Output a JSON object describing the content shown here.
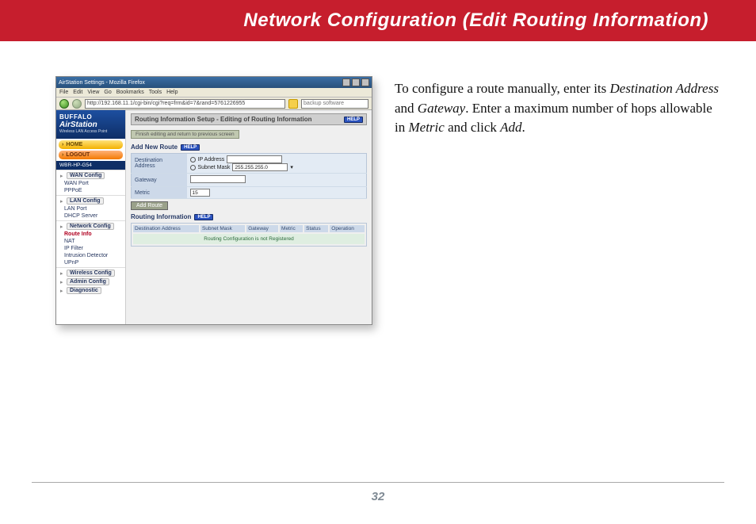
{
  "header": {
    "title": "Network Configuration (Edit Routing Information)"
  },
  "instructions": {
    "part1": "To configure a route manually, enter its ",
    "dest": "Destination Address",
    "part2": " and ",
    "gw": "Gateway",
    "part3": ".  Enter a maximum number of hops allowable in ",
    "metric": "Metric",
    "part4": " and click ",
    "add": "Add",
    "part5": "."
  },
  "page_number": "32",
  "browser": {
    "title": "AirStation Settings - Mozilla Firefox",
    "menus": [
      "File",
      "Edit",
      "View",
      "Go",
      "Bookmarks",
      "Tools",
      "Help"
    ],
    "url": "http://192.168.11.1/cgi-bin/cgi?req=frm&id=7&rand=5761226955",
    "search_placeholder": "backup software"
  },
  "sidebar": {
    "brand": "BUFFALO",
    "product": "AirStation",
    "tag": "Wireless LAN Access Point",
    "home": "HOME",
    "logout": "LOGOUT",
    "model": "WBR-HP-G54",
    "groups": [
      {
        "top": "WAN Config",
        "items": [
          "WAN Port",
          "PPPoE"
        ]
      },
      {
        "top": "LAN Config",
        "items": [
          "LAN Port",
          "DHCP Server"
        ]
      },
      {
        "top": "Network Config",
        "items_mixed": [
          {
            "label": "Route Info",
            "active": true
          },
          {
            "label": "NAT"
          },
          {
            "label": "IP Filter"
          },
          {
            "label": "Intrusion Detector"
          },
          {
            "label": "UPnP"
          }
        ]
      },
      {
        "top": "Wireless Config"
      },
      {
        "top": "Admin Config"
      },
      {
        "top": "Diagnostic"
      }
    ]
  },
  "main": {
    "breadcrumb": "Routing Information Setup - Editing of Routing Information",
    "help": "HELP",
    "finish_btn": "Finish editing and return to previous screen",
    "add_new_route": "Add New Route",
    "form": {
      "dest_label": "Destination Address",
      "ip_radio": "IP Address",
      "subnet_radio": "Subnet Mask",
      "subnet_value": "255.255.255.0",
      "gw_label": "Gateway",
      "metric_label": "Metric",
      "metric_value": "15",
      "add_btn": "Add Route"
    },
    "ri": {
      "title": "Routing Information",
      "cols": [
        "Destination Address",
        "Subnet Mask",
        "Gateway",
        "Metric",
        "Status",
        "Operation"
      ],
      "empty": "Routing Configuration is not Registered"
    }
  }
}
